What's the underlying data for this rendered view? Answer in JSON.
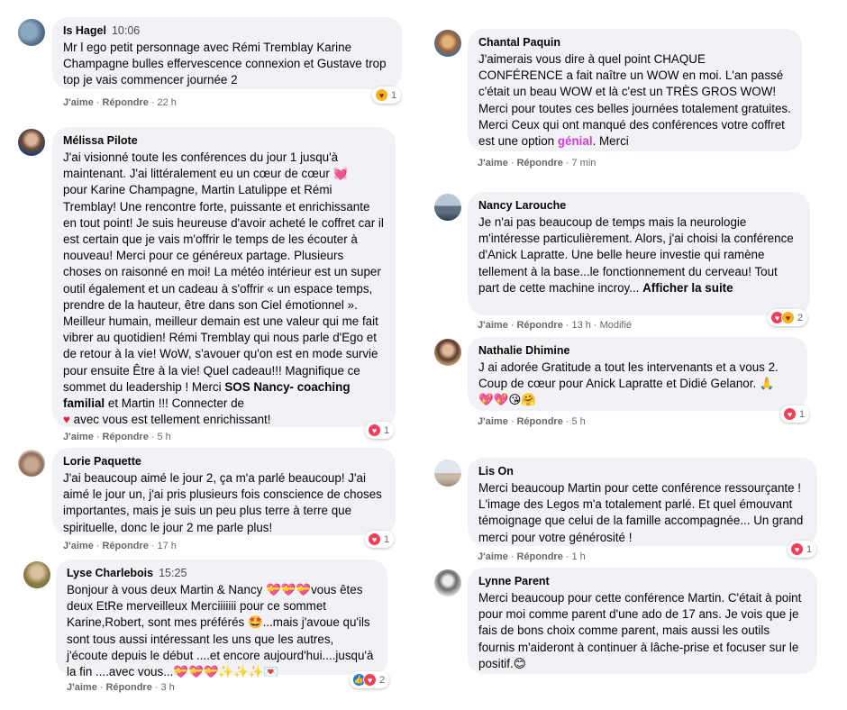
{
  "comments": {
    "c1": {
      "name": "Is Hagel",
      "time": "10:06",
      "text": "Mr l ego petit personnage avec Rémi Tremblay Karine Champagne bulles effervescence connexion et Gustave trop top je vais commencer journée 2",
      "like": "J'aime",
      "reply": "Répondre",
      "age": "22 h",
      "reaction_count": "1",
      "reaction_icons": [
        "care-icon"
      ]
    },
    "c2": {
      "name": "Mélissa Pilote",
      "text_a": "J'ai visionné toute les conférences du jour 1 jusqu'à maintenant. J'ai littéralement eu un cœur de cœur ",
      "emoji_a": "💓",
      "text_b": "\npour Karine Champagne, Martin Latulippe et Rémi Tremblay! Une rencontre forte, puissante et enrichissante en tout point! Je suis heureuse d'avoir acheté le coffret car il est certain que je vais m'offrir le temps de les écouter à nouveau! Merci pour ce généreux partage. Plusieurs choses on raisonné en moi! La météo intérieur est un super outil également et un cadeau à s'offrir « un espace temps, prendre de la hauteur, être dans son Ciel émotionnel ». Meilleur humain, meilleur demain est une valeur qui me fait vibrer au quotidien! Rémi Tremblay qui nous parle d'Ego et de retour à la vie! WoW, s'avouer qu'on est en mode survie pour ensuite Être à la vie! Quel cadeau!!! Magnifique ce sommet du leadership ! Merci ",
      "bold_b": "SOS Nancy- coaching familial",
      "text_c": " et Martin !!! Connecter de\n",
      "emoji_c": "♥",
      "text_d": " avec vous est tellement enrichissant!",
      "like": "J'aime",
      "reply": "Répondre",
      "age": "5 h",
      "reaction_count": "1",
      "reaction_icons": [
        "love-icon"
      ]
    },
    "c3": {
      "name": "Lorie Paquette",
      "text": "J'ai beaucoup aimé le jour 2, ça m'a parlé beaucoup! J'ai aimé le jour un, j'ai pris plusieurs fois conscience de choses importantes, mais je suis un peu plus terre à terre que spirituelle, donc le jour 2 me parle plus!",
      "like": "J'aime",
      "reply": "Répondre",
      "age": "17 h",
      "reaction_count": "1",
      "reaction_icons": [
        "love-icon"
      ]
    },
    "c4": {
      "name": "Lyse Charlebois",
      "time": "15:25",
      "text": "Bonjour à vous deux Martin & Nancy 💝💝💝vous êtes deux EtRe merveilleux Merciiiiiii pour ce sommet Karine,Robert, sont mes préférés 🤩...mais j'avoue qu'ils sont tous aussi intéressant les uns que les autres, j'écoute depuis le début ....et encore aujourd'hui....jusqu'à la fin ....avec vous...💝💝💝✨✨✨💌",
      "like": "J'aime",
      "reply": "Répondre",
      "age": "3 h",
      "reaction_count": "2",
      "reaction_icons": [
        "like-icon",
        "love-icon"
      ]
    },
    "c5": {
      "name": "Chantal Paquin",
      "text_a": "J'aimerais vous dire à quel point CHAQUE CONFÉRENCE a fait naître un WOW en moi. L'an passé c'était un beau WOW et là c'est un TRÈS GROS WOW! Merci pour toutes ces belles journées totalement gratuites. Merci Ceux qui ont manqué des conférences votre coffret est une option ",
      "highlight": "génial",
      "text_b": ". Merci",
      "like": "J'aime",
      "reply": "Répondre",
      "age": "7 min"
    },
    "c6": {
      "name": "Nancy Larouche",
      "text": "Je n'ai pas beaucoup de temps mais la neurologie m'intéresse particulièrement. Alors, j'ai choisi la conférence d'Anick Lapratte. Une belle heure investie qui ramène tellement à la base...le fonctionnement du cerveau! Tout part de cette machine incroy... ",
      "see_more": "Afficher la suite",
      "like": "J'aime",
      "reply": "Répondre",
      "age": "13 h",
      "edited": "Modifié",
      "reaction_count": "2",
      "reaction_icons": [
        "love-icon",
        "care-icon"
      ]
    },
    "c7": {
      "name": "Nathalie Dhimine",
      "text": "J ai adorée Gratitude a tout les intervenants et a vous 2. Coup de cœur pour Anick Lapratte et Didié Gelanor. 🙏\n💖💖😘🤗",
      "like": "J'aime",
      "reply": "Répondre",
      "age": "5 h",
      "reaction_count": "1",
      "reaction_icons": [
        "love-icon"
      ]
    },
    "c8": {
      "name": "Lis On",
      "text": "Merci beaucoup Martin pour cette conférence ressourçante ! L'image des Legos m'a totalement parlé. Et quel émouvant témoignage que celui de la famille accompagnée... Un grand merci pour votre générosité !",
      "like": "J'aime",
      "reply": "Répondre",
      "age": "1 h",
      "reaction_count": "1",
      "reaction_icons": [
        "love-icon"
      ]
    },
    "c9": {
      "name": "Lynne Parent",
      "text": "Merci beaucoup pour cette conférence Martin. C'était à point pour moi comme parent d'une ado de 17 ans. Je vois que je fais de bons choix comme parent, mais aussi les outils fournis m'aideront à continuer à lâche-prise et focuser sur le positif.😊"
    }
  }
}
